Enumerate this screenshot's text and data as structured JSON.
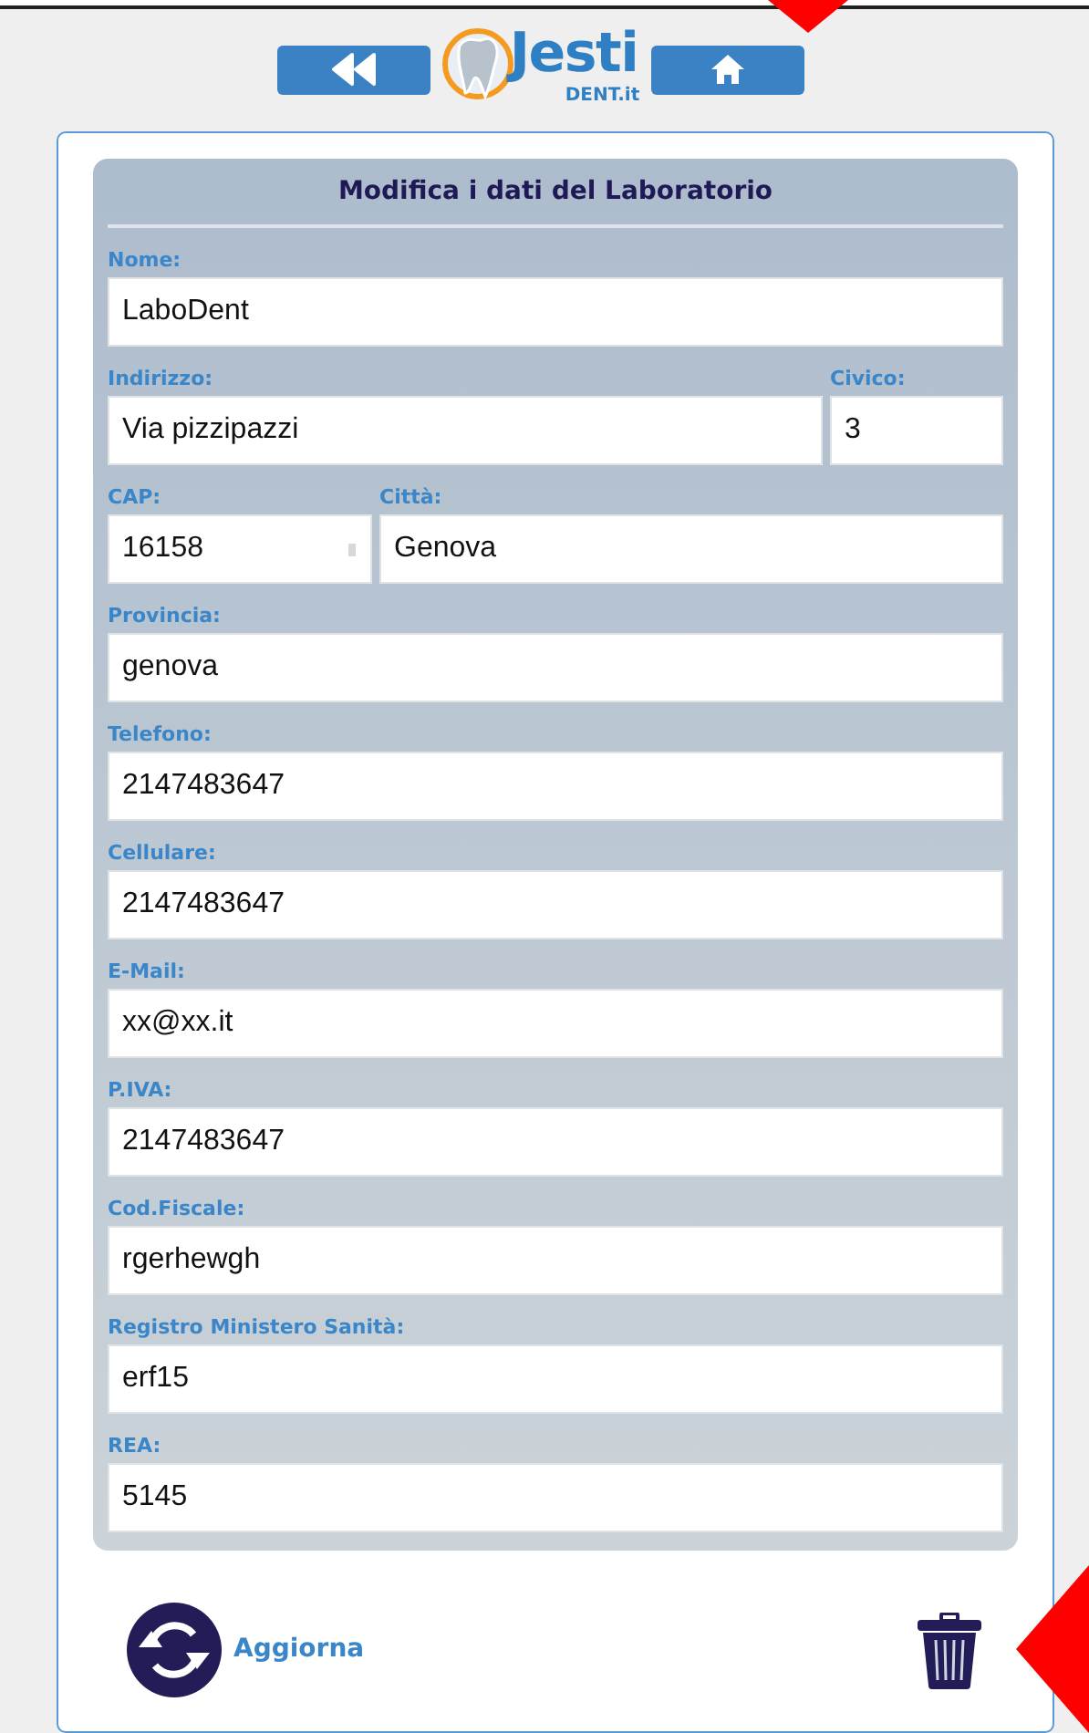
{
  "header": {
    "logo": {
      "brand": "Jesti",
      "suffix": "DENT.it"
    }
  },
  "form": {
    "title": "Modifica i dati del Laboratorio",
    "rows": [
      [
        {
          "label": "Nome:",
          "value": "LaboDent",
          "kind": "text"
        }
      ],
      [
        {
          "label": "Indirizzo:",
          "value": "Via pizzipazzi",
          "kind": "text"
        },
        {
          "label": "Civico:",
          "value": "3",
          "kind": "text"
        }
      ],
      [
        {
          "label": "CAP:",
          "value": "16158",
          "kind": "number"
        },
        {
          "label": "Città:",
          "value": "Genova",
          "kind": "text"
        }
      ],
      [
        {
          "label": "Provincia:",
          "value": "genova",
          "kind": "text"
        }
      ],
      [
        {
          "label": "Telefono:",
          "value": "2147483647",
          "kind": "text"
        }
      ],
      [
        {
          "label": "Cellulare:",
          "value": "2147483647",
          "kind": "text"
        }
      ],
      [
        {
          "label": "E-Mail:",
          "value": "xx@xx.it",
          "kind": "text"
        }
      ],
      [
        {
          "label": "P.IVA:",
          "value": "2147483647",
          "kind": "text"
        }
      ],
      [
        {
          "label": "Cod.Fiscale:",
          "value": "rgerhewgh",
          "kind": "text"
        }
      ],
      [
        {
          "label": "Registro Ministero Sanità:",
          "value": "erf15",
          "kind": "text"
        }
      ],
      [
        {
          "label": "REA:",
          "value": "5145",
          "kind": "text"
        }
      ]
    ]
  },
  "actions": {
    "update": "Aggiorna"
  }
}
